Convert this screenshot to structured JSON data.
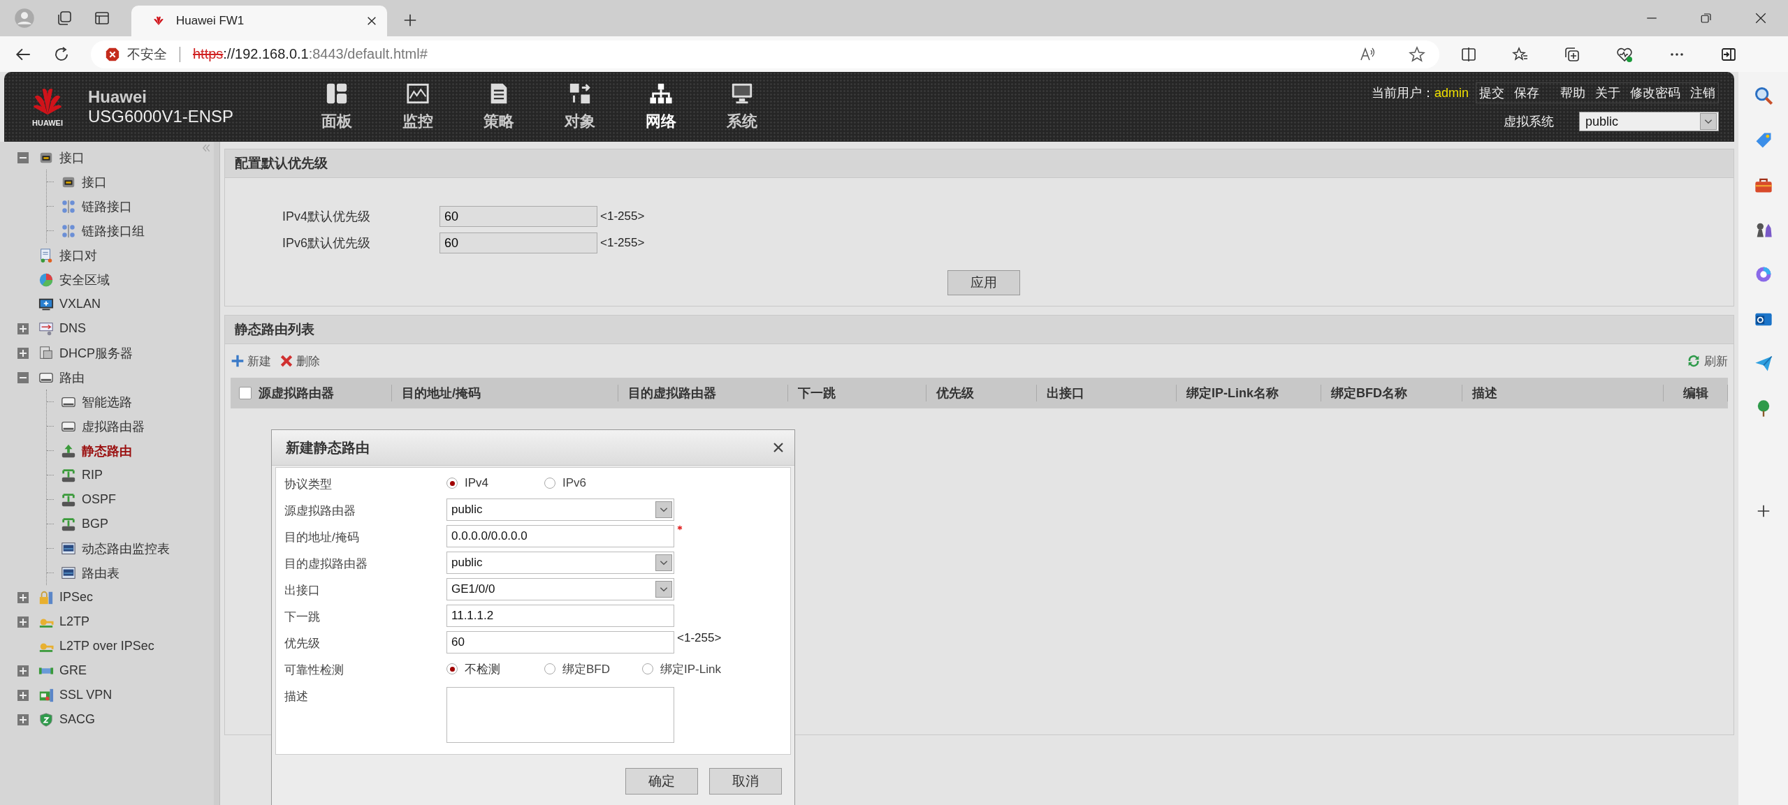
{
  "browser": {
    "tab_title": "Huawei FW1",
    "security_label": "不安全",
    "url": [
      {
        "kind": "scheme",
        "text": "https"
      },
      {
        "kind": "host",
        "text": "://192.168.0.1"
      },
      {
        "kind": "rest",
        "text": ":8443/default.html#"
      }
    ]
  },
  "header": {
    "logo_text": "HUAWEI",
    "brand": "Huawei",
    "model": "USG6000V1-ENSP",
    "nav": [
      {
        "kind": "dashboard",
        "label": "面板",
        "selected": false
      },
      {
        "kind": "monitor",
        "label": "监控",
        "selected": false
      },
      {
        "kind": "policy",
        "label": "策略",
        "selected": false
      },
      {
        "kind": "object",
        "label": "对象",
        "selected": false
      },
      {
        "kind": "network",
        "label": "网络",
        "selected": true
      },
      {
        "kind": "system",
        "label": "系统",
        "selected": false
      }
    ],
    "user_label": "当前用户：",
    "user": "admin",
    "actions": [
      "提交",
      "保存",
      "帮助",
      "关于",
      "修改密码",
      "注销"
    ],
    "vsys_label": "虚拟系统",
    "vsys_value": "public"
  },
  "tree": [
    {
      "label": "接口",
      "kind": "port",
      "expanded": true,
      "selected": false,
      "children": [
        {
          "label": "接口",
          "kind": "port",
          "selected": false
        },
        {
          "label": "链路接口",
          "kind": "link",
          "selected": false
        },
        {
          "label": "链路接口组",
          "kind": "link",
          "selected": false
        }
      ]
    },
    {
      "label": "接口对",
      "kind": "pair",
      "selected": false
    },
    {
      "label": "安全区域",
      "kind": "zone",
      "selected": false
    },
    {
      "label": "VXLAN",
      "kind": "monitor",
      "selected": false
    },
    {
      "label": "DNS",
      "kind": "dns",
      "expanded": false,
      "selected": false
    },
    {
      "label": "DHCP服务器",
      "kind": "server",
      "expanded": false,
      "selected": false
    },
    {
      "label": "路由",
      "kind": "router",
      "expanded": true,
      "selected": false,
      "children": [
        {
          "label": "智能选路",
          "kind": "router",
          "selected": false
        },
        {
          "label": "虚拟路由器",
          "kind": "router",
          "selected": false
        },
        {
          "label": "静态路由",
          "kind": "static",
          "selected": true
        },
        {
          "label": "RIP",
          "kind": "protocol",
          "selected": false
        },
        {
          "label": "OSPF",
          "kind": "protocol",
          "selected": false
        },
        {
          "label": "BGP",
          "kind": "protocol",
          "selected": false
        },
        {
          "label": "动态路由监控表",
          "kind": "table",
          "selected": false
        },
        {
          "label": "路由表",
          "kind": "table",
          "selected": false
        }
      ]
    },
    {
      "label": "IPSec",
      "kind": "lock",
      "expanded": false,
      "selected": false
    },
    {
      "label": "L2TP",
      "kind": "key",
      "expanded": false,
      "selected": false
    },
    {
      "label": "L2TP over IPSec",
      "kind": "key",
      "selected": false
    },
    {
      "label": "GRE",
      "kind": "tunnel",
      "expanded": false,
      "selected": false
    },
    {
      "label": "SSL VPN",
      "kind": "vpn",
      "expanded": false,
      "selected": false
    },
    {
      "label": "SACG",
      "kind": "shield",
      "expanded": false,
      "selected": false
    }
  ],
  "priority_panel": {
    "title": "配置默认优先级",
    "fields": [
      {
        "label": "IPv4默认优先级",
        "value": "60",
        "hint": "<1-255>"
      },
      {
        "label": "IPv6默认优先级",
        "value": "60",
        "hint": "<1-255>"
      }
    ],
    "apply": "应用"
  },
  "route_panel": {
    "title": "静态路由列表",
    "toolbar": [
      {
        "kind": "add",
        "label": "新建"
      },
      {
        "kind": "delete",
        "label": "删除"
      }
    ],
    "refresh": "刷新",
    "select_all_checked": false,
    "columns": [
      "源虚拟路由器",
      "目的地址/掩码",
      "目的虚拟路由器",
      "下一跳",
      "优先级",
      "出接口",
      "绑定IP-Link名称",
      "绑定BFD名称",
      "描述",
      "编辑"
    ]
  },
  "dialog": {
    "title": "新建静态路由",
    "rows": [
      {
        "kind": "radio",
        "label": "协议类型",
        "options": [
          {
            "label": "IPv4",
            "selected": true
          },
          {
            "label": "IPv6",
            "selected": false
          }
        ]
      },
      {
        "kind": "select",
        "label": "源虚拟路由器",
        "value": "public"
      },
      {
        "kind": "text",
        "label": "目的地址/掩码",
        "value": "0.0.0.0/0.0.0.0",
        "required": true
      },
      {
        "kind": "select",
        "label": "目的虚拟路由器",
        "value": "public"
      },
      {
        "kind": "select",
        "label": "出接口",
        "value": "GE1/0/0"
      },
      {
        "kind": "text",
        "label": "下一跳",
        "value": "11.1.1.2",
        "required": false
      },
      {
        "kind": "text",
        "label": "优先级",
        "value": "60",
        "required": false,
        "hint": "<1-255>"
      },
      {
        "kind": "radio",
        "label": "可靠性检测",
        "options": [
          {
            "label": "不检测",
            "selected": true
          },
          {
            "label": "绑定BFD",
            "selected": false
          },
          {
            "label": "绑定IP-Link",
            "selected": false
          }
        ]
      },
      {
        "kind": "textarea",
        "label": "描述"
      }
    ],
    "buttons": [
      "确定",
      "取消"
    ]
  }
}
